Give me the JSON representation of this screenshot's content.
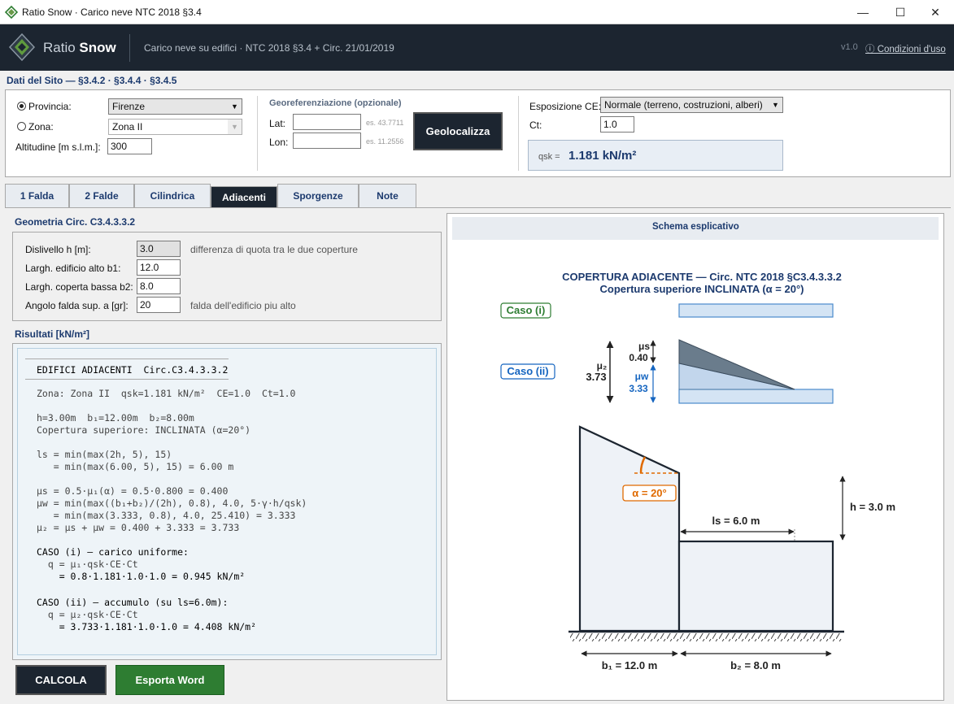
{
  "window": {
    "title": "Ratio Snow  ·  Carico neve NTC 2018 §3.4",
    "min": "—",
    "max": "☐",
    "close": "✕"
  },
  "header": {
    "brand_light": "Ratio",
    "brand_bold": "Snow",
    "subtitle": "Carico neve su edifici  ·  NTC 2018 §3.4  +  Circ. 21/01/2019",
    "version": "v1.0",
    "conditions": "ⓘ Condizioni d'uso"
  },
  "site": {
    "section_title": "Dati del Sito  —  §3.4.2 · §3.4.4 · §3.4.5",
    "provincia_label": "Provincia:",
    "provincia_value": "Firenze",
    "zona_label": "Zona:",
    "zona_value": "Zona II",
    "altitude_label": "Altitudine [m s.l.m.]:",
    "altitude_value": "300",
    "geo_title": "Georeferenziazione (opzionale)",
    "lat_label": "Lat:",
    "lat_placeholder": "es. 43.7711",
    "lon_label": "Lon:",
    "lon_placeholder": "es. 11.2556",
    "geolocate": "Geolocalizza",
    "exposure_label": "Esposizione CE:",
    "exposure_value": "Normale  (terreno, costruzioni, alberi)",
    "ct_label": "Ct:",
    "ct_value": "1.0",
    "qsk_label": "qsk =",
    "qsk_value": "1.181 kN/m²"
  },
  "tabs": [
    {
      "label": "1 Falda"
    },
    {
      "label": "2 Falde"
    },
    {
      "label": "Cilindrica"
    },
    {
      "label": "Adiacenti"
    },
    {
      "label": "Sporgenze"
    },
    {
      "label": "Note"
    }
  ],
  "geometry": {
    "title": "Geometria  Circ. C3.4.3.3.2",
    "dislivello_label": "Dislivello h [m]:",
    "dislivello_value": "3.0",
    "dislivello_hint": "differenza di quota tra le due coperture",
    "b1_label": "Largh. edificio alto b1:",
    "b1_value": "12.0",
    "b2_label": "Largh. coperta bassa b2:",
    "b2_value": "8.0",
    "angle_label": "Angolo falda sup. a [gr]:",
    "angle_value": "20",
    "angle_hint": "falda dell'edificio piu alto"
  },
  "results": {
    "title": "Risultati [kN/m²]",
    "lines": [
      "EDIFICI ADIACENTI  Circ.C3.4.3.3.2",
      "Zona: Zona II  qsk=1.181 kN/m²  CE=1.0  Ct=1.0",
      "h=3.00m  b₁=12.00m  b₂=8.00m",
      "Copertura superiore: INCLINATA (α=20°)",
      "ls = min(max(2h, 5), 15)",
      "   = min(max(6.00, 5), 15) = 6.00 m",
      "μs = 0.5·μ₁(α) = 0.5·0.800 = 0.400",
      "μw = min(max((b₁+b₂)/(2h), 0.8), 4.0, 5·γ·h/qsk)",
      "   = min(max(3.333, 0.8), 4.0, 25.410) = 3.333",
      "μ₂ = μs + μw = 0.400 + 3.333 = 3.733",
      "CASO (i) — carico uniforme:",
      "  q = μ₁·qsk·CE·Ct",
      "    = 0.8·1.181·1.0·1.0 = 0.945 kN/m²",
      "CASO (ii) — accumulo (su ls=6.0m):",
      "  q = μ₂·qsk·CE·Ct",
      "    = 3.733·1.181·1.0·1.0 = 4.408 kN/m²"
    ]
  },
  "actions": {
    "calcola": "CALCOLA",
    "export": "Esporta Word"
  },
  "schema": {
    "title": "Schema esplicativo",
    "heading1": "COPERTURA ADIACENTE  —  Circ. NTC 2018 §C3.4.3.3.2",
    "heading2": "Copertura superiore INCLINATA  (α = 20°)",
    "caso_i": "Caso (i)",
    "caso_ii": "Caso (ii)",
    "mu2_label": "μ₂",
    "mu2_value": "3.73",
    "mus_label": "μs",
    "mus_value": "0.40",
    "muw_label": "μw",
    "muw_value": "3.33",
    "alpha_label": "α = 20°",
    "ls_label": "ls = 6.0 m",
    "h_label": "h = 3.0 m",
    "b1_label": "b₁ = 12.0 m",
    "b2_label": "b₂ = 8.0 m",
    "colors": {
      "navy": "#1c3a6e",
      "green": "#2e7d32",
      "blue": "#1565c0",
      "orange": "#e06a00"
    }
  }
}
